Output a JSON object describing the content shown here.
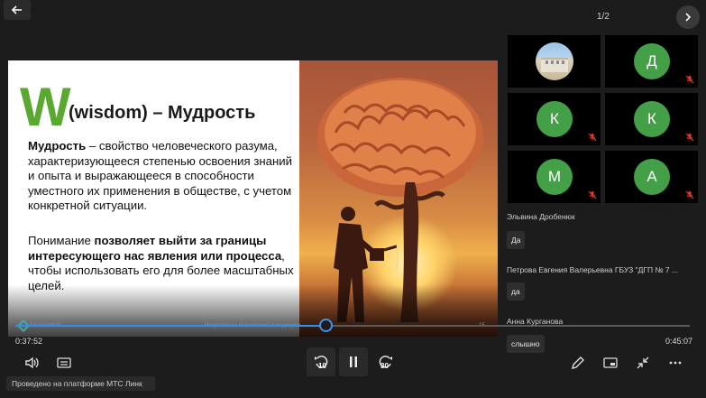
{
  "header": {
    "pager": "1/2"
  },
  "slide": {
    "w_letter": "W",
    "title": "(wisdom) – Мудрость",
    "p1_bold": "Мудрость",
    "p1_rest": " – свойство человеческого разума, характеризующееся степенью освоения знаний и опыта и выражающееся в способности уместного их применения в обществе, с учетом конкретной ситуации.",
    "p2_start": "Понимание ",
    "p2_bold": "позволяет выйти за границы интересующего нас явления или процесса",
    "p2_end": ", чтобы использовать его для более масштабных целей.",
    "footer_left": "Калашников",
    "footer_mid": "Искусственный интеллект в медицине",
    "footer_page": "15"
  },
  "player": {
    "current_time": "0:37:52",
    "total_time": "0:45:07",
    "progress": 0.46,
    "skip_back": "10",
    "skip_forward": "30"
  },
  "platform_label": "Проведено на платформе МТС Линк",
  "participants": [
    {
      "initial": "",
      "type": "photo",
      "muted": false
    },
    {
      "initial": "Д",
      "type": "letter",
      "muted": true
    },
    {
      "initial": "К",
      "type": "letter",
      "muted": true
    },
    {
      "initial": "К",
      "type": "letter",
      "muted": true
    },
    {
      "initial": "М",
      "type": "letter",
      "muted": true
    },
    {
      "initial": "А",
      "type": "letter",
      "muted": true
    }
  ],
  "chat": [
    {
      "name": "Эльвина Дробенюк",
      "reply": "Да"
    },
    {
      "name": "Петрова Евгения Валерьевна ГБУЗ \"ДГП № 7 ...",
      "reply": "да"
    },
    {
      "name": "Анна Курганова",
      "reply": "слышно"
    }
  ],
  "colors": {
    "accent": "#2f8ff0",
    "avatar": "#43a047",
    "w_green": "#59a82f"
  }
}
